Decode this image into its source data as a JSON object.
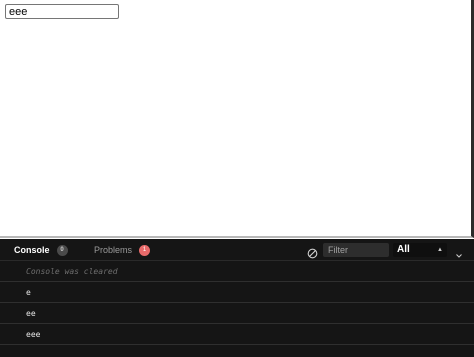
{
  "preview": {
    "input_value": "eee"
  },
  "console": {
    "tabs": [
      {
        "label": "Console",
        "count": "0"
      },
      {
        "label": "Problems",
        "count": "1"
      }
    ],
    "filter_placeholder": "Filter",
    "level": "All",
    "logs": [
      {
        "text": "Console was cleared"
      },
      {
        "text": "e"
      },
      {
        "text": "ee"
      },
      {
        "text": "eee"
      }
    ],
    "icons": [
      "clear-console-icon",
      "collapse-chevron-icon",
      "select-arrows-icon"
    ]
  }
}
